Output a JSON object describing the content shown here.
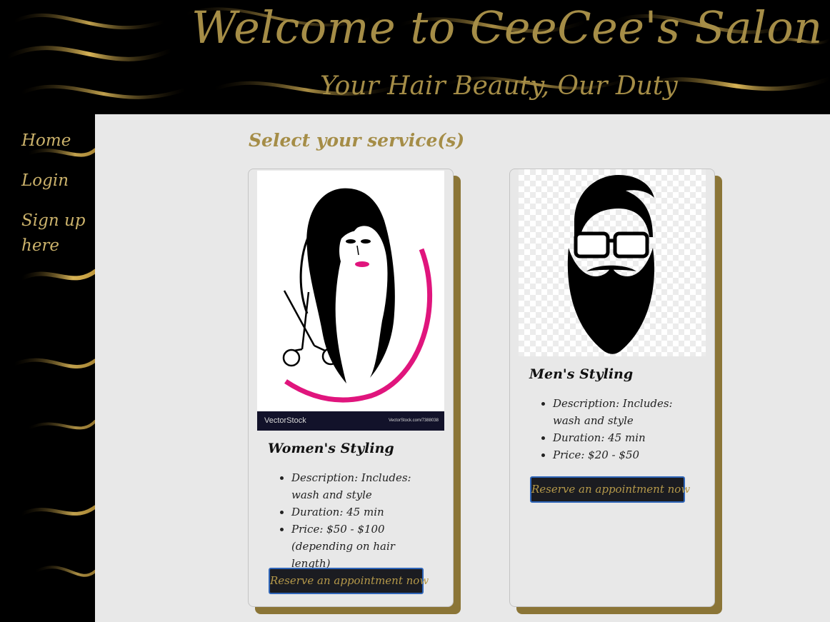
{
  "header": {
    "title": "Welcome to CeeCee's Salon",
    "subtitle": "Your Hair Beauty, Our Duty"
  },
  "nav": {
    "items": [
      {
        "label": "Home"
      },
      {
        "label": "Login"
      },
      {
        "label": "Sign up here"
      }
    ]
  },
  "main": {
    "title": "Select your service(s)",
    "cards": [
      {
        "name": "Women's Styling",
        "description": "Description: Includes: wash and style",
        "duration": "Duration: 45 min",
        "price": "Price: $50 - $100 (depending on hair length)",
        "button": "Reserve an appointment now",
        "image": {
          "icon": "woman-hair-icon",
          "watermark_brand": "VectorStock",
          "watermark_url": "VectorStock.com/7388038"
        }
      },
      {
        "name": "Men's Styling",
        "description": "Description: Includes: wash and style",
        "duration": "Duration: 45 min",
        "price": "Price: $20 - $50",
        "button": "Reserve an appointment now",
        "image": {
          "icon": "bearded-man-icon"
        }
      }
    ]
  },
  "colors": {
    "gold": "#a58d47",
    "dark": "#1b1c21",
    "card_shadow": "#8b7537",
    "panel": "#e8e8e8",
    "button_border": "#2f65b8"
  }
}
